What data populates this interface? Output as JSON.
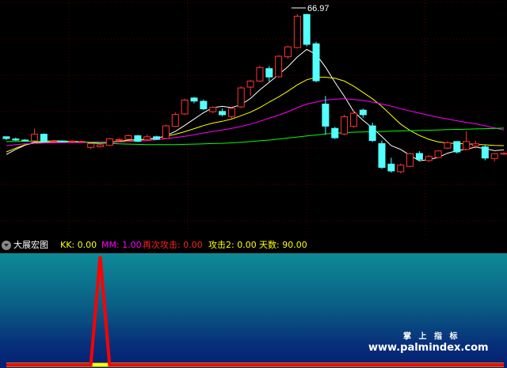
{
  "main_chart": {
    "max_price_label": "66.97",
    "chart_data": {
      "type": "candlestick",
      "title": "",
      "candles": [
        [
          18.5,
          18.6,
          17.2,
          17.8
        ],
        [
          17.6,
          18.2,
          16.9,
          17.2
        ],
        [
          17.2,
          17.5,
          16.6,
          17.1
        ],
        [
          16.9,
          21.7,
          16.6,
          19.5
        ],
        [
          19.5,
          19.8,
          16.3,
          16.6
        ],
        [
          16.8,
          17.1,
          16.4,
          16.8
        ],
        [
          16.8,
          17.0,
          16.5,
          16.6
        ],
        [
          16.6,
          17.1,
          16.2,
          16.8
        ],
        [
          16.6,
          16.9,
          16.2,
          16.7
        ],
        [
          14.3,
          16.4,
          13.6,
          15.8
        ],
        [
          14.6,
          16.1,
          14.3,
          15.3
        ],
        [
          15.1,
          18.0,
          14.9,
          17.7
        ],
        [
          17.2,
          17.9,
          16.6,
          17.4
        ],
        [
          17.5,
          19.3,
          17.3,
          18.9
        ],
        [
          18.9,
          19.2,
          16.4,
          16.7
        ],
        [
          17.3,
          19.4,
          16.9,
          18.5
        ],
        [
          18.5,
          18.9,
          17.2,
          17.5
        ],
        [
          17.8,
          23.3,
          17.6,
          22.8
        ],
        [
          22.6,
          28.1,
          22.3,
          27.3
        ],
        [
          27.5,
          33.5,
          27.1,
          33.0
        ],
        [
          33.8,
          34.2,
          31.7,
          32.6
        ],
        [
          32.5,
          33.2,
          29.1,
          29.5
        ],
        [
          28.4,
          30.5,
          27.8,
          30.1
        ],
        [
          28.5,
          29.6,
          26.6,
          27.2
        ],
        [
          26.5,
          30.0,
          25.7,
          29.7
        ],
        [
          30.3,
          38.4,
          29.8,
          37.8
        ],
        [
          38.1,
          40.9,
          34.7,
          40.5
        ],
        [
          40.5,
          46.6,
          40.2,
          45.8
        ],
        [
          45.4,
          46.4,
          40.3,
          42.1
        ],
        [
          42.2,
          50.7,
          41.9,
          50.3
        ],
        [
          50.1,
          54.4,
          49.3,
          54.0
        ],
        [
          53.7,
          66.9,
          53.4,
          66.1
        ],
        [
          66.8,
          67.0,
          54.2,
          55.0
        ],
        [
          55.2,
          56.0,
          40.0,
          40.6
        ],
        [
          31.4,
          34.6,
          19.3,
          22.7
        ],
        [
          21.8,
          22.4,
          17.6,
          18.1
        ],
        [
          19.6,
          27.2,
          19.1,
          26.4
        ],
        [
          22.6,
          28.6,
          22.1,
          27.8
        ],
        [
          29.0,
          29.6,
          26.0,
          27.2
        ],
        [
          22.8,
          24.1,
          16.4,
          17.0
        ],
        [
          15.8,
          17.0,
          5.8,
          6.4
        ],
        [
          7.7,
          10.2,
          4.3,
          5.0
        ],
        [
          4.7,
          7.9,
          4.1,
          7.3
        ],
        [
          6.8,
          12.2,
          6.5,
          11.8
        ],
        [
          11.9,
          12.8,
          9.0,
          9.6
        ],
        [
          9.1,
          11.3,
          8.6,
          10.7
        ],
        [
          10.3,
          13.2,
          10.2,
          12.9
        ],
        [
          14.0,
          16.8,
          13.6,
          16.1
        ],
        [
          16.6,
          16.7,
          11.9,
          12.5
        ],
        [
          13.5,
          20.7,
          13.1,
          16.6
        ],
        [
          14.9,
          16.9,
          13.9,
          15.7
        ],
        [
          14.5,
          15.2,
          9.2,
          10.1
        ],
        [
          9.9,
          12.1,
          8.8,
          11.8
        ],
        [
          11.6,
          12.4,
          11.3,
          12.0
        ]
      ],
      "ma_series": [
        {
          "color": "#ffffff",
          "values": [
            11.5,
            13.5,
            15.2,
            16.4,
            16.7,
            16.9,
            16.8,
            16.7,
            16.6,
            16.0,
            15.9,
            16.1,
            16.6,
            17.2,
            17.3,
            17.5,
            17.8,
            18.9,
            20.6,
            23.0,
            25.5,
            28.0,
            30.0,
            30.5,
            30.0,
            31.2,
            33.6,
            37.0,
            40.0,
            43.0,
            46.2,
            50.0,
            53.0,
            51.0,
            46.0,
            40.0,
            34.5,
            28.5,
            25.0,
            22.0,
            18.6,
            15.0,
            13.5,
            11.2,
            9.0,
            9.5,
            10.3,
            12.0,
            13.0,
            13.6,
            14.4,
            13.8,
            13.0,
            13.3
          ]
        },
        {
          "color": "#ffff00",
          "values": [
            12.5,
            14.0,
            15.3,
            16.0,
            16.3,
            16.4,
            16.5,
            16.5,
            16.4,
            16.3,
            16.3,
            16.5,
            16.7,
            17.1,
            17.3,
            17.6,
            18.0,
            18.7,
            19.5,
            20.5,
            21.7,
            22.9,
            23.9,
            24.6,
            25.5,
            26.8,
            28.2,
            30.0,
            32.2,
            34.2,
            36.5,
            39.0,
            41.0,
            42.0,
            42.0,
            41.6,
            40.5,
            38.5,
            36.0,
            33.5,
            30.5,
            27.0,
            23.5,
            21.0,
            19.0,
            17.5,
            16.5,
            16.0,
            15.8,
            15.7,
            15.5,
            15.3,
            15.1,
            15.0
          ]
        },
        {
          "color": "#ff00ff",
          "values": [
            15.0,
            15.4,
            15.7,
            15.9,
            16.0,
            16.1,
            16.2,
            16.2,
            16.2,
            16.3,
            16.3,
            16.4,
            16.5,
            16.6,
            16.8,
            17.0,
            17.3,
            17.7,
            18.2,
            18.7,
            19.3,
            20.0,
            20.6,
            21.2,
            21.8,
            22.6,
            23.5,
            24.6,
            25.8,
            27.0,
            28.4,
            30.0,
            31.4,
            32.2,
            33.0,
            33.3,
            33.5,
            33.2,
            32.8,
            32.2,
            31.4,
            30.6,
            29.6,
            28.7,
            27.8,
            27.0,
            26.2,
            25.5,
            24.8,
            24.2,
            23.6,
            22.8,
            22.0,
            21.2
          ]
        },
        {
          "color": "#00ff00",
          "values": [
            16.6,
            16.6,
            16.7,
            16.7,
            16.7,
            16.6,
            16.5,
            16.5,
            16.4,
            16.3,
            16.1,
            15.9,
            15.7,
            15.6,
            15.5,
            15.4,
            15.4,
            15.4,
            15.4,
            15.5,
            15.6,
            15.7,
            15.8,
            15.9,
            16.1,
            16.3,
            16.6,
            16.9,
            17.2,
            17.6,
            18.0,
            18.4,
            18.8,
            19.2,
            19.6,
            19.9,
            20.1,
            20.3,
            20.4,
            20.5,
            20.6,
            20.7,
            20.8,
            20.9,
            21.0,
            21.1,
            21.2,
            21.3,
            21.4,
            21.5,
            21.6,
            21.7,
            21.8,
            21.9
          ]
        }
      ],
      "price_min": 0,
      "price_max": 70
    }
  },
  "indicator_bar": {
    "name": "大展宏图",
    "kk_label": "KK: 0.00",
    "mm_label": "MM: 1.00",
    "attack_label": "再次攻击: 0.00",
    "attack2_label": "攻击2: 0.00",
    "days_label": "天数: 90.00",
    "colors": {
      "name": "#ffffff",
      "kk": "#ffff00",
      "mm": "#ff00ff",
      "attack": "#ff2020",
      "attack2": "#ffff00",
      "days": "#ffff00"
    }
  },
  "sub_chart": {
    "chart_data": {
      "type": "line",
      "title": "",
      "series": [
        {
          "color": "#ff0000",
          "values": [
            0,
            0,
            0,
            0,
            0,
            0,
            0,
            0,
            0,
            0,
            1,
            0,
            0,
            0,
            0,
            0,
            0,
            0,
            0,
            0,
            0,
            0,
            0,
            0,
            0,
            0,
            0,
            0,
            0,
            0,
            0,
            0,
            0,
            0,
            0,
            0,
            0,
            0,
            0,
            0,
            0,
            0,
            0,
            0,
            0,
            0,
            0,
            0,
            0,
            0,
            0,
            0,
            0,
            0
          ]
        },
        {
          "color": "#ffff00",
          "values": [
            0,
            0,
            0,
            0,
            0,
            0,
            0,
            0,
            0,
            0,
            0,
            0,
            0,
            0,
            0,
            0,
            0,
            0,
            0,
            0,
            0,
            0,
            0,
            0,
            0,
            0,
            0,
            0,
            0,
            0,
            0,
            0,
            0,
            0,
            0,
            0,
            0,
            0,
            0,
            0,
            0,
            0,
            0,
            0,
            0,
            0,
            0,
            0,
            0,
            0,
            0,
            0,
            0,
            0
          ]
        }
      ],
      "ylim": [
        0,
        1
      ]
    }
  },
  "watermark": {
    "line1": "掌 上 指 标",
    "line2": "www.palmindex.com"
  }
}
